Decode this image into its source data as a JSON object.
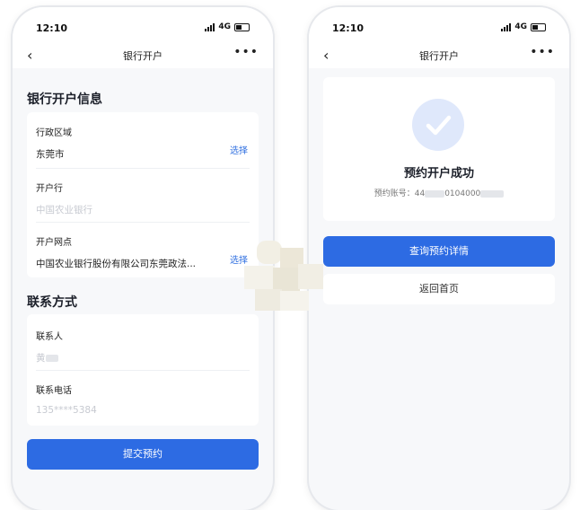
{
  "left_phone": {
    "status": {
      "time": "12:10",
      "network": "4G"
    },
    "nav": {
      "title": "银行开户"
    },
    "section_account": "银行开户信息",
    "region": {
      "label": "行政区域",
      "value": "东莞市",
      "action": "选择"
    },
    "bank": {
      "label": "开户行",
      "placeholder": "中国农业银行"
    },
    "branch": {
      "label": "开户网点",
      "value": "中国农业银行股份有限公司东莞政法...",
      "action": "选择"
    },
    "section_contact": "联系方式",
    "contact": {
      "label": "联系人",
      "value": "黄"
    },
    "phone": {
      "label": "联系电话",
      "value": "135****5384"
    },
    "submit_label": "提交预约"
  },
  "right_phone": {
    "status": {
      "time": "12:10",
      "network": "4G"
    },
    "nav": {
      "title": "银行开户"
    },
    "success_title": "预约开户成功",
    "account": {
      "label": "预约账号：",
      "prefix": "44",
      "middle": "0104000"
    },
    "query_label": "查询预约详情",
    "home_label": "返回首页"
  },
  "colors": {
    "primary": "#2d6be3",
    "link": "#2f6fe0",
    "check_bg": "#dfe8fb"
  },
  "icons": [
    "back-arrow-icon",
    "more-icon",
    "signal-icon",
    "battery-icon",
    "check-icon"
  ]
}
